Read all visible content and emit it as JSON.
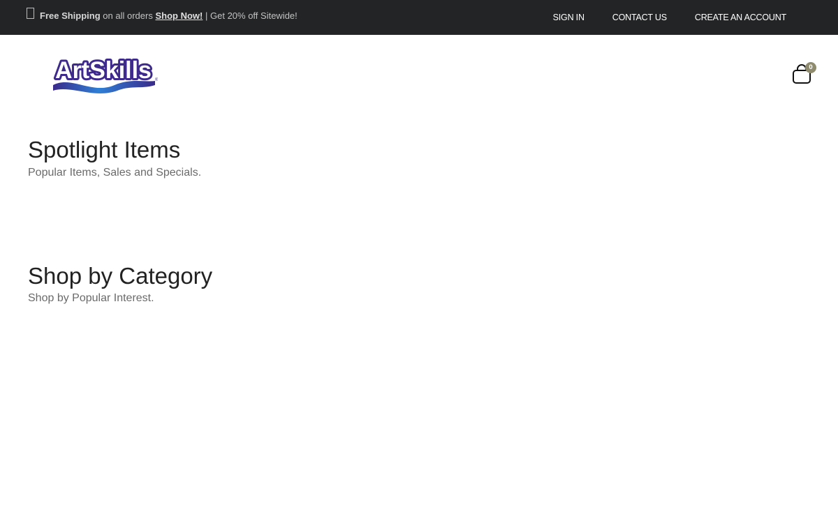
{
  "promo": {
    "bold_lead": "Free Shipping",
    "middle": "on all orders",
    "link": "Shop Now!",
    "separator": "|",
    "tail": "Get 20% off Sitewide!"
  },
  "topnav": {
    "sign_in": "SIGN IN",
    "contact": "CONTACT US",
    "create_account": "CREATE AN ACCOUNT"
  },
  "logo": {
    "text": "ArtSkills"
  },
  "cart": {
    "count": "0"
  },
  "sections": {
    "spotlight": {
      "title": "Spotlight Items",
      "subtitle": "Popular Items, Sales and Specials."
    },
    "category": {
      "title": "Shop by Category",
      "subtitle": "Shop by Popular Interest."
    }
  },
  "colors": {
    "topbar_bg": "#222426",
    "badge": "#8f8b6e",
    "logo_purple": "#3d2a8c",
    "logo_blue": "#1d8fe0"
  }
}
